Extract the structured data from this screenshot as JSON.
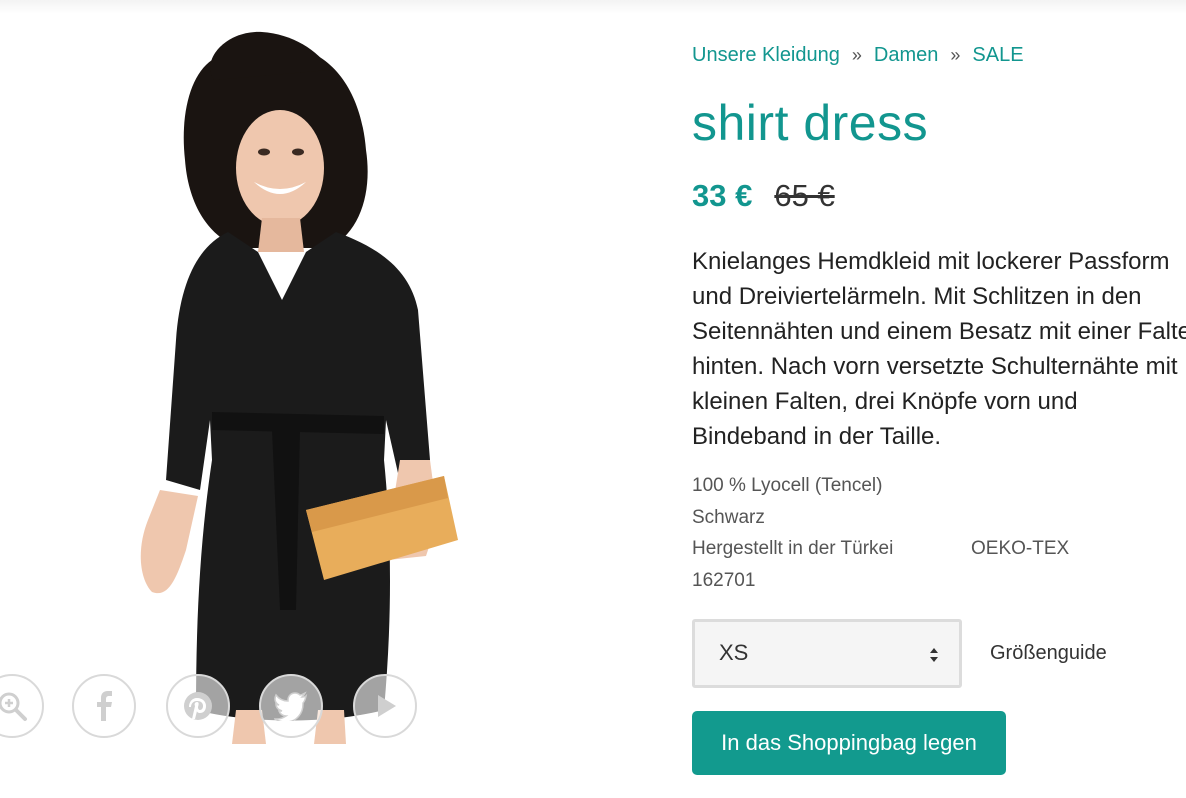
{
  "breadcrumb": {
    "items": [
      {
        "label": "Unsere Kleidung"
      },
      {
        "label": "Damen"
      },
      {
        "label": "SALE"
      }
    ],
    "separator": "»"
  },
  "product": {
    "title": "shirt dress",
    "price_sale": "33 €",
    "price_original": "65 €",
    "description_lines": [
      "Knielanges Hemdkleid mit lockerer Passform",
      "und Dreiviertelärmeln. Mit Schlitzen in den",
      "Seitennähten und einem Besatz mit einer Falte",
      "hinten. Nach vorn versetzte Schulternähte mit",
      "kleinen Falten, drei Knöpfe vorn und",
      "Bindeband in der Taille."
    ],
    "material": "100 % Lyocell (Tencel)",
    "color": "Schwarz",
    "origin": "Hergestellt in der Türkei",
    "certification": "OEKO-TEX",
    "article_number": "162701"
  },
  "size_select": {
    "value": "XS"
  },
  "size_guide_label": "Größenguide",
  "cart_button_label": "In das Shoppingbag legen",
  "share_icons": [
    "zoom-icon",
    "facebook-icon",
    "pinterest-icon",
    "twitter-icon",
    "play-icon"
  ],
  "colors": {
    "accent": "#12968f",
    "button": "#129a8e",
    "dress": "#1b1b1b",
    "clutch": "#e8ad5b",
    "skin": "#efc7ae",
    "hair": "#1a1411"
  }
}
